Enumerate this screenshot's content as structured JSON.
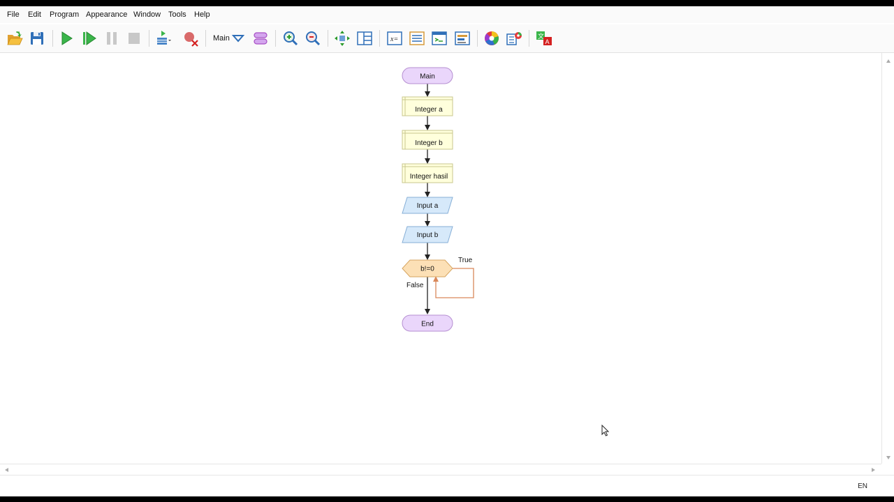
{
  "menu": {
    "items": [
      "File",
      "Edit",
      "Program",
      "Appearance",
      "Window",
      "Tools",
      "Help"
    ]
  },
  "toolbar": {
    "function_selector": "Main"
  },
  "flowchart": {
    "start_label": "Main",
    "declares": [
      "Integer a",
      "Integer b",
      "Integer hasil"
    ],
    "inputs": [
      "Input a",
      "Input b"
    ],
    "loop_condition": "b!=0",
    "true_label": "True",
    "false_label": "False",
    "end_label": "End"
  },
  "status": {
    "language": "EN"
  },
  "colors": {
    "terminal_fill": "#ead6fb",
    "terminal_stroke": "#b58fd1",
    "declare_fill": "#ffffdc",
    "declare_stroke": "#c9c78e",
    "io_fill": "#d6e9fa",
    "io_stroke": "#86aed6",
    "loop_fill": "#fce0b6",
    "loop_stroke": "#d6a560",
    "loop_line": "#d9885a"
  }
}
